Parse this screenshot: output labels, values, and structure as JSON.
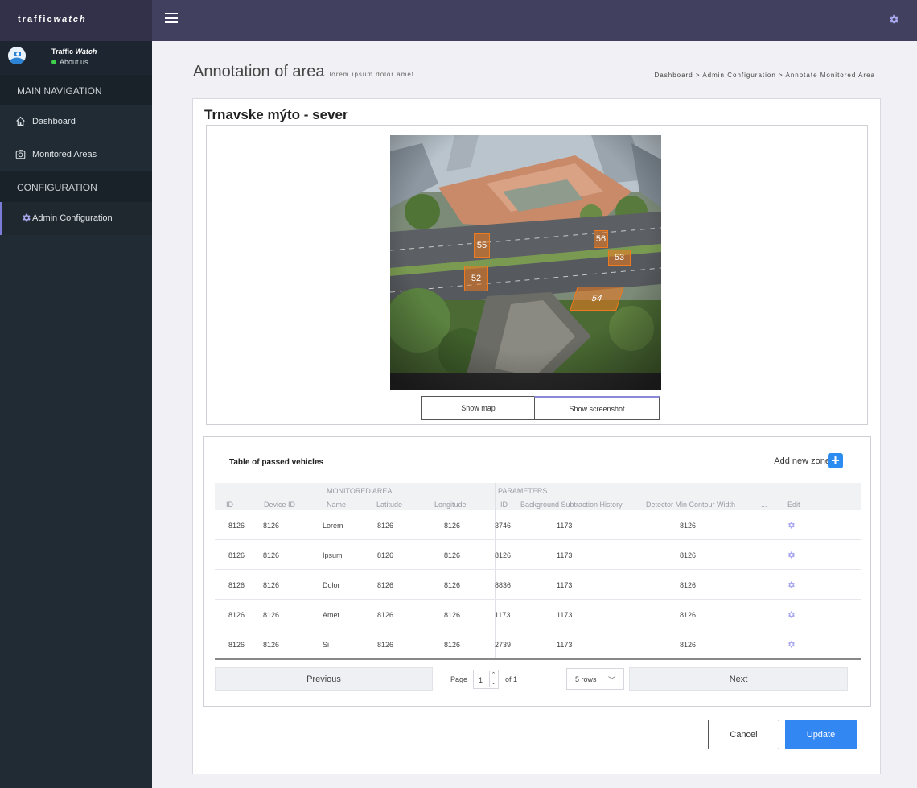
{
  "app": {
    "brand_plain": "traffic",
    "brand_italic": "watch"
  },
  "user": {
    "name_plain": "Traffic ",
    "name_italic": "Watch",
    "status": "About us"
  },
  "sidebar": {
    "header_main": "MAIN NAVIGATION",
    "header_config": "CONFIGURATION",
    "items": [
      {
        "label": "Dashboard",
        "icon": "home-icon"
      },
      {
        "label": "Monitored Areas",
        "icon": "camera-icon"
      },
      {
        "label": "Admin Configuration",
        "icon": "gear-icon"
      }
    ]
  },
  "page": {
    "title": "Annotation of area",
    "subtitle": "lorem ipsum dolor amet",
    "breadcrumb": "Dashboard > Admin Configuration > Annotate Monitored Area"
  },
  "area": {
    "name": "Trnavske mýto - sever"
  },
  "zones": [
    "55",
    "56",
    "53",
    "52",
    "54"
  ],
  "view_toggle": {
    "map": "Show map",
    "screenshot": "Show screenshot"
  },
  "table": {
    "title": "Table of passed vehicles",
    "add_zone": "Add new zone",
    "add_icon": "plus-icon",
    "group_monitored": "MONITORED AREA",
    "group_parameters": "PARAMETERS",
    "columns": [
      "ID",
      "Device ID",
      "Name",
      "Latitude",
      "Longitude",
      "ID",
      "Background Subtraction History",
      "Detector Min Contour Width",
      "...",
      "Edit"
    ],
    "rows": [
      [
        "8126",
        "8126",
        "Lorem",
        "8126",
        "8126",
        "3746",
        "1173",
        "8126"
      ],
      [
        "8126",
        "8126",
        "Ipsum",
        "8126",
        "8126",
        "8126",
        "1173",
        "8126"
      ],
      [
        "8126",
        "8126",
        "Dolor",
        "8126",
        "8126",
        "8836",
        "1173",
        "8126"
      ],
      [
        "8126",
        "8126",
        "Amet",
        "8126",
        "8126",
        "1173",
        "1173",
        "8126"
      ],
      [
        "8126",
        "8126",
        "Si",
        "8126",
        "8126",
        "2739",
        "1173",
        "8126"
      ]
    ]
  },
  "pagination": {
    "previous": "Previous",
    "next": "Next",
    "page_label": "Page",
    "page_value": "1",
    "of_label": "of 1",
    "rows_option": "5 rows"
  },
  "actions": {
    "cancel": "Cancel",
    "update": "Update"
  },
  "colors": {
    "accent": "#3287f2",
    "zone": "#f07a1e",
    "sidebar": "#202b33",
    "topbar": "#41405e"
  }
}
